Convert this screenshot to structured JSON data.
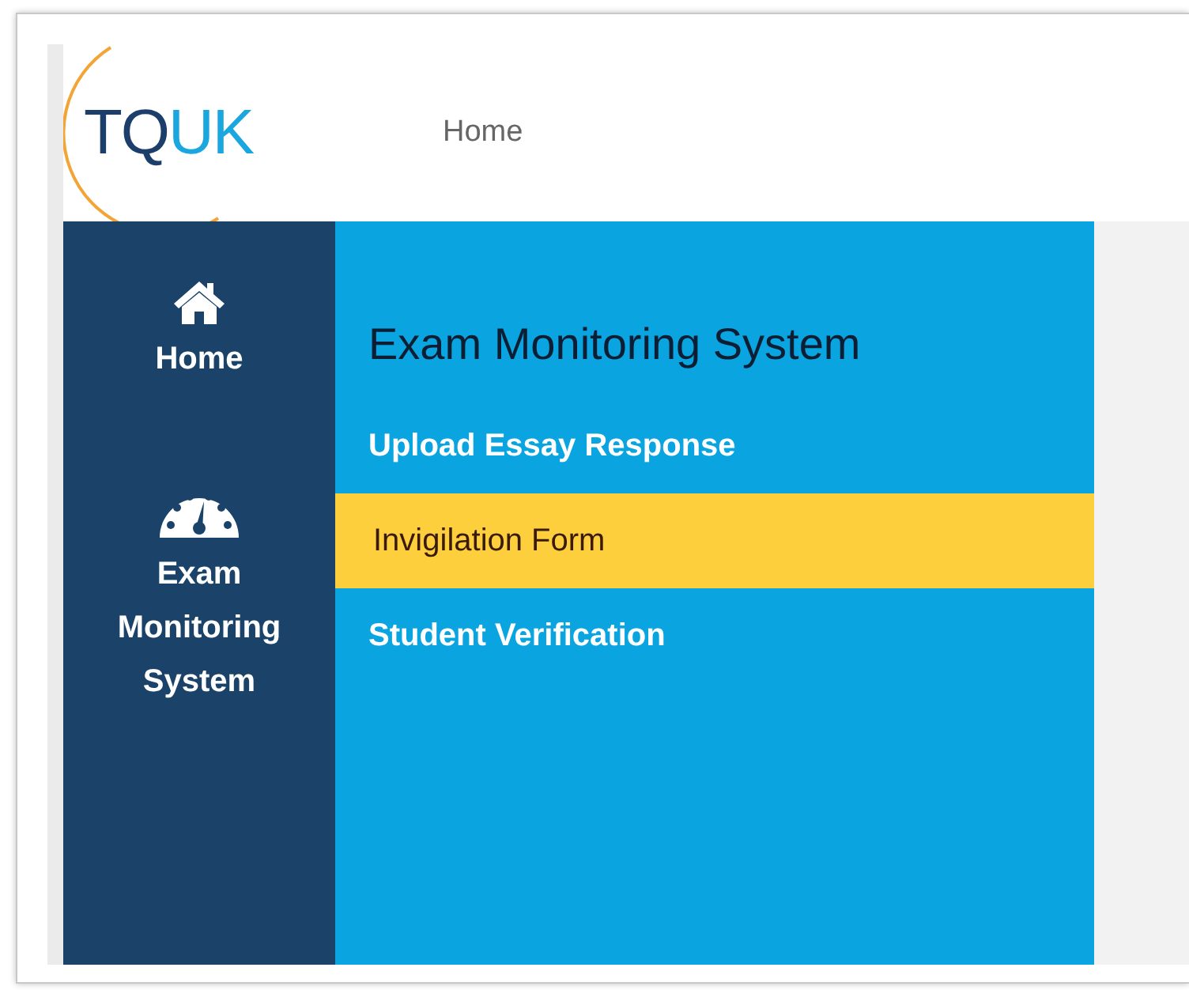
{
  "header": {
    "logo": {
      "dark_part": "TQ",
      "light_part": "UK"
    },
    "nav": [
      {
        "label": "Home"
      }
    ]
  },
  "sidebar": {
    "items": [
      {
        "kind": "home",
        "label": "Home"
      },
      {
        "kind": "gauge",
        "label": "Exam Monitoring System"
      }
    ]
  },
  "panel": {
    "title": "Exam Monitoring System",
    "items": [
      {
        "label": "Upload Essay Response",
        "selected": false
      },
      {
        "label": "Invigilation Form",
        "selected": true
      },
      {
        "label": "Student Verification",
        "selected": false
      }
    ]
  }
}
